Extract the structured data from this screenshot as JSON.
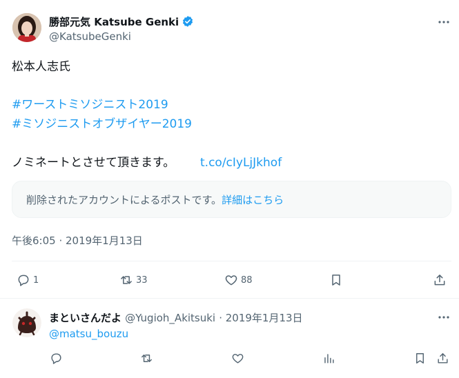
{
  "tweet": {
    "author_name": "勝部元気 Katsube Genki",
    "author_handle": "@KatsubeGenki",
    "lines": {
      "l1": "松本人志氏",
      "l2": "#ワーストミソジニスト2019",
      "l3": "#ミソジニストオブザイヤー2019",
      "l4": "ノミネートとさせて頂きます。",
      "l4_link": "t.co/cIyLjJkhof"
    },
    "notice": {
      "text": "削除されたアカウントによるポストです。",
      "link": "詳細はこちら"
    },
    "timestamp": "午後6:05 · 2019年1月13日",
    "stats": {
      "replies": "1",
      "reposts": "33",
      "likes": "88"
    },
    "colors": {
      "link": "#1d9bf0",
      "verified": "#1d9bf0",
      "muted": "#536471"
    }
  },
  "reply": {
    "author_name": "まといさんだよ",
    "author_handle": "@Yugioh_Akitsuki",
    "date": "· 2019年1月13日",
    "mention": "@matsu_bouzu"
  }
}
